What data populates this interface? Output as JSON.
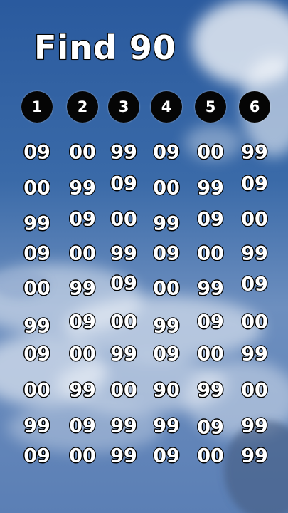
{
  "title": "Find 90",
  "columns": [
    "1",
    "2",
    "3",
    "4",
    "5",
    "6"
  ],
  "rows": [
    [
      "09",
      "00",
      "99",
      "09",
      "00",
      "99"
    ],
    [
      "00",
      "99",
      "09",
      "00",
      "99",
      "09"
    ],
    [
      "99",
      "09",
      "00",
      "99",
      "09",
      "00"
    ],
    [
      "09",
      "00",
      "99",
      "09",
      "00",
      "99"
    ],
    [
      "00",
      "99",
      "09",
      "00",
      "99",
      "09"
    ],
    [
      "99",
      "09",
      "00",
      "99",
      "09",
      "00"
    ],
    [
      "09",
      "00",
      "99",
      "09",
      "00",
      "99"
    ],
    [
      "00",
      "99",
      "00",
      "90",
      "99",
      "00"
    ],
    [
      "99",
      "09",
      "99",
      "99",
      "09",
      "99"
    ],
    [
      "09",
      "00",
      "99",
      "09",
      "00",
      "99"
    ]
  ],
  "colors": {
    "sky_top": "#2f5fa0",
    "sky_bottom": "#5f80b8",
    "text": "#ffffff",
    "outline": "#000000",
    "badge": "#050505"
  }
}
